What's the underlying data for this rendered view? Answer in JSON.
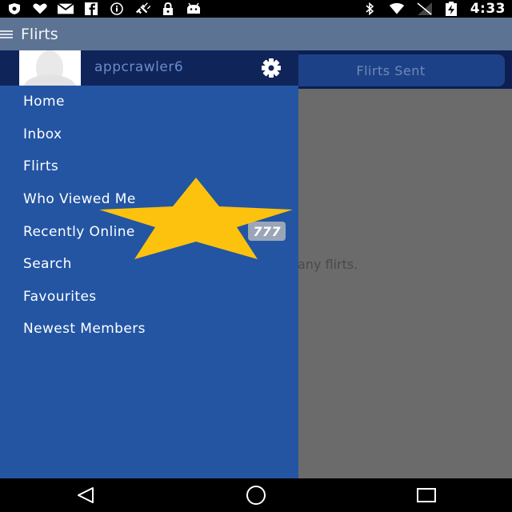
{
  "status_bar": {
    "time": "4:33",
    "left_icons": [
      "shield-icon",
      "heart-icon",
      "mail-icon",
      "facebook-icon",
      "info-icon",
      "satellite-icon",
      "lock-icon",
      "android-icon"
    ],
    "right_icons": [
      "bluetooth-icon",
      "wifi-icon",
      "signal-icon",
      "battery-charging-icon"
    ]
  },
  "app_bar": {
    "title": "Flirts"
  },
  "content": {
    "tab_label": "Flirts Sent",
    "empty_message": "any flirts."
  },
  "drawer": {
    "username": "appcrawler6",
    "menu": [
      {
        "label": "Home"
      },
      {
        "label": "Inbox"
      },
      {
        "label": "Flirts"
      },
      {
        "label": "Who Viewed Me"
      },
      {
        "label": "Recently Online",
        "badge": "777"
      },
      {
        "label": "Search"
      },
      {
        "label": "Favourites"
      },
      {
        "label": "Newest Members"
      }
    ]
  },
  "colors": {
    "drawer_bg": "#2355a3",
    "drawer_header_bg": "#0f2459",
    "app_bar_bg": "#5d7393",
    "star": "#fdc20e"
  }
}
